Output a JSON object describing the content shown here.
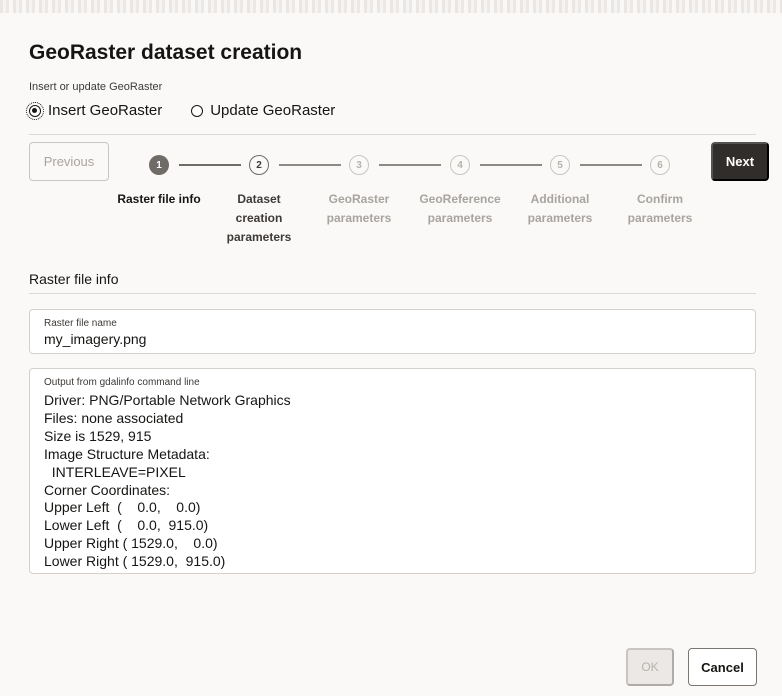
{
  "dialog": {
    "title": "GeoRaster dataset creation"
  },
  "mode": {
    "label": "Insert or update GeoRaster",
    "options": [
      {
        "label": "Insert GeoRaster",
        "selected": true
      },
      {
        "label": "Update GeoRaster",
        "selected": false
      }
    ]
  },
  "wizard": {
    "previous_label": "Previous",
    "next_label": "Next",
    "steps": [
      {
        "number": "1",
        "label": "Raster file info",
        "state": "done"
      },
      {
        "number": "2",
        "label": "Dataset\ncreation\nparameters",
        "state": "current"
      },
      {
        "number": "3",
        "label": "GeoRaster\nparameters",
        "state": "future"
      },
      {
        "number": "4",
        "label": "GeoReference\nparameters",
        "state": "future"
      },
      {
        "number": "5",
        "label": "Additional\nparameters",
        "state": "future"
      },
      {
        "number": "6",
        "label": "Confirm\nparameters",
        "state": "future"
      }
    ]
  },
  "section": {
    "heading": "Raster file info"
  },
  "raster_file": {
    "label": "Raster file name",
    "value": "my_imagery.png"
  },
  "gdalinfo": {
    "label": "Output from gdalinfo command line",
    "lines": [
      "Driver: PNG/Portable Network Graphics",
      "Files: none associated",
      "Size is 1529, 915",
      "Image Structure Metadata:",
      "  INTERLEAVE=PIXEL",
      "Corner Coordinates:",
      "Upper Left  (    0.0,    0.0)",
      "Lower Left  (    0.0,  915.0)",
      "Upper Right ( 1529.0,    0.0)",
      "Lower Right ( 1529.0,  915.0)"
    ]
  },
  "footer": {
    "ok_label": "OK",
    "cancel_label": "Cancel"
  },
  "colors": {
    "primary_button": "#312d2a",
    "step_done": "#6f6b67",
    "background": "#fbf9f8"
  }
}
